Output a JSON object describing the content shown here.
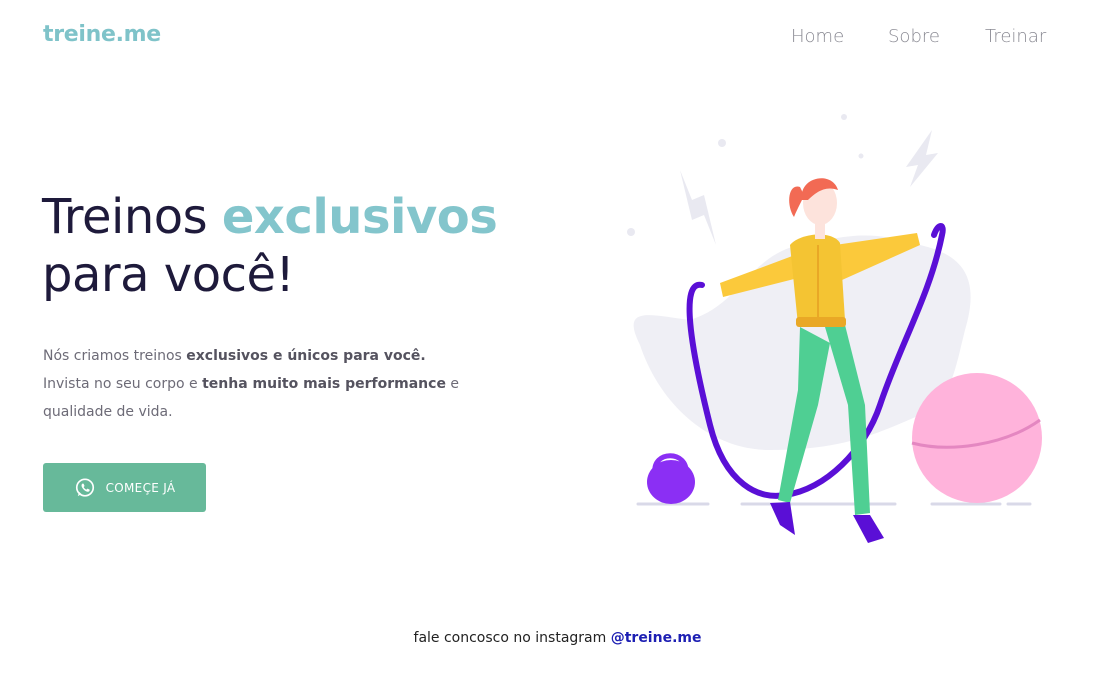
{
  "header": {
    "logo": "treine.me",
    "nav": [
      {
        "label": "Home"
      },
      {
        "label": "Sobre"
      },
      {
        "label": "Treinar"
      }
    ]
  },
  "hero": {
    "title_part1": "Treinos",
    "title_accent": "exclusivos",
    "title_part2": "para você!",
    "text": {
      "line1_a": "Nós criamos treinos ",
      "line1_b": "exclusivos e únicos para você.",
      "line2_a": "Invista no seu corpo e ",
      "line2_b": "tenha muito mais performance",
      "line2_c": " e",
      "line3": "qualidade de vida."
    },
    "cta_label": "COMEÇE JÁ",
    "cta_icon": "whatsapp-icon"
  },
  "footer": {
    "text": "fale concosco no instagram ",
    "handle": "@treine.me"
  },
  "colors": {
    "accent": "#83c5cc",
    "logo": "#7fc3c9",
    "cta": "#67b99a",
    "heading": "#1e1a3b",
    "link": "#1d1fb3"
  }
}
